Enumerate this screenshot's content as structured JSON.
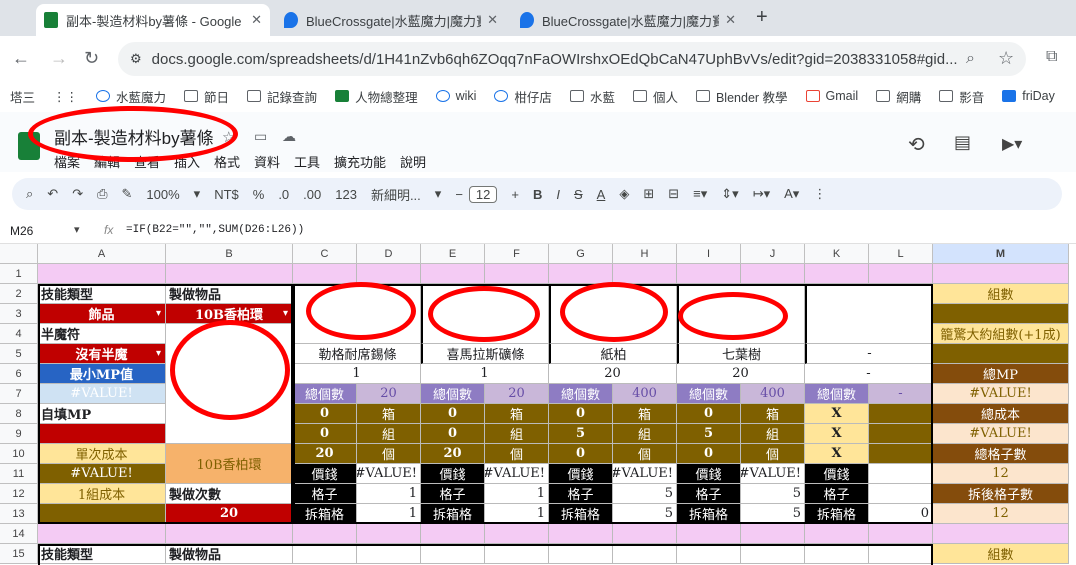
{
  "browser": {
    "tabs": [
      {
        "title": "副本-製造材料by薯條 - Google",
        "active": true
      },
      {
        "title": "BlueCrossgate|水藍魔力|魔力寶",
        "active": false
      },
      {
        "title": "BlueCrossgate|水藍魔力|魔力寶",
        "active": false
      }
    ],
    "url": "docs.google.com/spreadsheets/d/1H41nZvb6qh6ZOqq7nFaOWIrshxOEdQbCaN47UphBvVs/edit?gid=2038331058#gid...",
    "bookmarks": [
      "塔三",
      "水藍魔力",
      "節日",
      "記錄查詢",
      "人物總整理",
      "wiki",
      "柑仔店",
      "水藍",
      "個人",
      "Blender 教學",
      "Gmail",
      "網購",
      "影音",
      "friDay"
    ]
  },
  "doc": {
    "title": "副本-製造材料by薯條",
    "menu": [
      "檔案",
      "編輯",
      "查看",
      "插入",
      "格式",
      "資料",
      "工具",
      "擴充功能",
      "說明"
    ],
    "toolbar": {
      "zoom": "100%",
      "currency": "NT$",
      "percent": "%",
      "dec_dec": ".0",
      "inc_dec": ".00",
      "numfmt": "123",
      "font": "新細明...",
      "font_size": "12"
    }
  },
  "formula": {
    "cell_ref": "M26",
    "fx": "fx",
    "text": "=IF(B22=\"\",\"\",SUM(D26:L26))"
  },
  "columns": [
    "A",
    "B",
    "C",
    "D",
    "E",
    "F",
    "G",
    "H",
    "I",
    "J",
    "K",
    "L",
    "M"
  ],
  "rows": [
    "1",
    "2",
    "3",
    "4",
    "5",
    "6",
    "7",
    "8",
    "9",
    "10",
    "11",
    "12",
    "13",
    "14",
    "15"
  ],
  "cells": {
    "A2": "技能類型",
    "B2": "製做物品",
    "M2": "組數",
    "A3": "飾品",
    "B3": "10B香柏環",
    "A4": "半魔符",
    "M4": "籠驚大約組數(+1成)",
    "A5": "沒有半魔",
    "C5": "勒格耐席錫條",
    "E5": "喜馬拉斯礦條",
    "G5": "紙柏",
    "I5": "七葉樹",
    "K5": "-",
    "A6": "最小MP值",
    "C6": "1",
    "E6": "1",
    "G6": "20",
    "I6": "20",
    "K6": "-",
    "M6": "總MP",
    "A7": "#VALUE!",
    "C7": "總個數",
    "D7": "20",
    "E7": "總個數",
    "F7": "20",
    "G7": "總個數",
    "H7": "400",
    "I7": "總個數",
    "J7": "400",
    "K7": "總個數",
    "L7": "-",
    "M7": "#VALUE!",
    "A8": "自填MP",
    "C8": "0",
    "D8": "箱",
    "E8": "0",
    "F8": "箱",
    "G8": "0",
    "H8": "箱",
    "I8": "0",
    "J8": "箱",
    "K8": "X",
    "M8": "總成本",
    "C9": "0",
    "D9": "組",
    "E9": "0",
    "F9": "組",
    "G9": "5",
    "H9": "組",
    "I9": "5",
    "J9": "組",
    "K9": "X",
    "M9": "#VALUE!",
    "A10": "單次成本",
    "B10": "10B香柏環",
    "C10": "20",
    "D10": "個",
    "E10": "20",
    "F10": "個",
    "G10": "0",
    "H10": "個",
    "I10": "0",
    "J10": "個",
    "K10": "X",
    "M10": "總格子數",
    "A11": "#VALUE!",
    "C11": "價錢",
    "D11": "#VALUE!",
    "E11": "價錢",
    "F11": "#VALUE!",
    "G11": "價錢",
    "H11": "#VALUE!",
    "I11": "價錢",
    "J11": "#VALUE!",
    "K11": "價錢",
    "M11": "12",
    "A12": "1組成本",
    "B12": "製做次數",
    "C12": "格子",
    "D12": "1",
    "E12": "格子",
    "F12": "1",
    "G12": "格子",
    "H12": "5",
    "I12": "格子",
    "J12": "5",
    "K12": "格子",
    "M12": "拆後格子數",
    "B13": "20",
    "C13": "拆箱格",
    "D13": "1",
    "E13": "拆箱格",
    "F13": "1",
    "G13": "拆箱格",
    "H13": "5",
    "I13": "拆箱格",
    "J13": "5",
    "K13": "拆箱格",
    "L13": "0",
    "M13": "12",
    "A15": "技能類型",
    "B15": "製做物品",
    "M15": "組數"
  },
  "colors": {
    "lavender": "#f4cbf4",
    "dark_red": "#c00000",
    "gold": "#ffe599",
    "olive": "#7f6000",
    "brown": "#844c0c",
    "blue": "#2764c4",
    "purple": "#c9b7d9",
    "peach": "#fce5cd",
    "highlight": "#d3e3fd"
  }
}
